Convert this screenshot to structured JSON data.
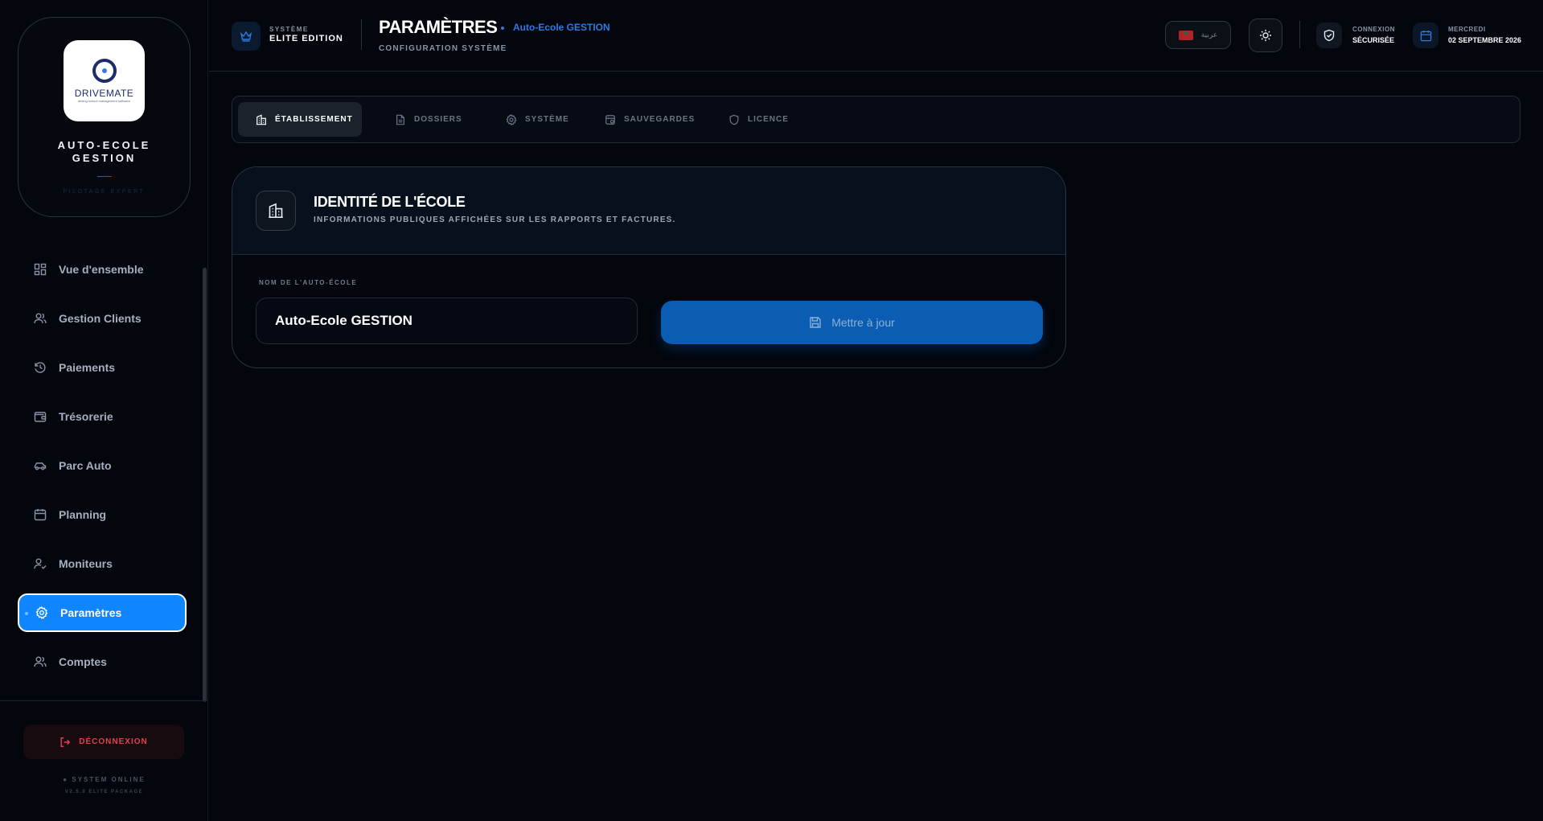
{
  "brand": {
    "logo_text": "DRIVEMATE",
    "logo_tagline": "driving school management software",
    "name": "AUTO-ECOLE GESTION",
    "tagline": "PILOTAGE EXPERT"
  },
  "sidebar": {
    "items": [
      {
        "label": "Vue d'ensemble",
        "icon": "dashboard-icon",
        "active": false
      },
      {
        "label": "Gestion Clients",
        "icon": "users-icon",
        "active": false
      },
      {
        "label": "Paiements",
        "icon": "history-icon",
        "active": false
      },
      {
        "label": "Trésorerie",
        "icon": "wallet-icon",
        "active": false
      },
      {
        "label": "Parc Auto",
        "icon": "car-icon",
        "active": false
      },
      {
        "label": "Planning",
        "icon": "calendar-icon",
        "active": false
      },
      {
        "label": "Moniteurs",
        "icon": "user-check-icon",
        "active": false
      },
      {
        "label": "Paramètres",
        "icon": "gear-icon",
        "active": true
      },
      {
        "label": "Comptes",
        "icon": "users-icon",
        "active": false
      }
    ],
    "logout_label": "DÉCONNEXION",
    "status": "● SYSTEM ONLINE",
    "version": "V2.5.0 ELITE PACKAGE"
  },
  "header": {
    "system_small": "SYSTÈME",
    "system_big": "ELITE EDITION",
    "title": "PARAMÈTRES",
    "title_context": "Auto-Ecole GESTION",
    "subtitle": "CONFIGURATION SYSTÈME",
    "language_label": "عربية",
    "connection_small": "CONNEXION",
    "connection_big": "SÉCURISÉE",
    "day": "MERCREDI",
    "date": "02 SEPTEMBRE 2026"
  },
  "tabs": [
    {
      "label": "ÉTABLISSEMENT",
      "icon": "building-icon",
      "active": true
    },
    {
      "label": "DOSSIERS",
      "icon": "document-icon",
      "active": false
    },
    {
      "label": "SYSTÈME",
      "icon": "gear-icon",
      "active": false
    },
    {
      "label": "SAUVEGARDES",
      "icon": "database-icon",
      "active": false
    },
    {
      "label": "LICENCE",
      "icon": "shield-icon",
      "active": false
    }
  ],
  "identity_card": {
    "title": "IDENTITÉ DE L'ÉCOLE",
    "subtitle": "INFORMATIONS PUBLIQUES AFFICHÉES SUR LES RAPPORTS ET FACTURES.",
    "field_label": "NOM DE L'AUTO-ÉCOLE",
    "field_value": "Auto-Ecole GESTION",
    "button_label": "Mettre à jour"
  },
  "colors": {
    "accent": "#0f86ff",
    "background": "#03060d",
    "danger": "#e0424f"
  }
}
